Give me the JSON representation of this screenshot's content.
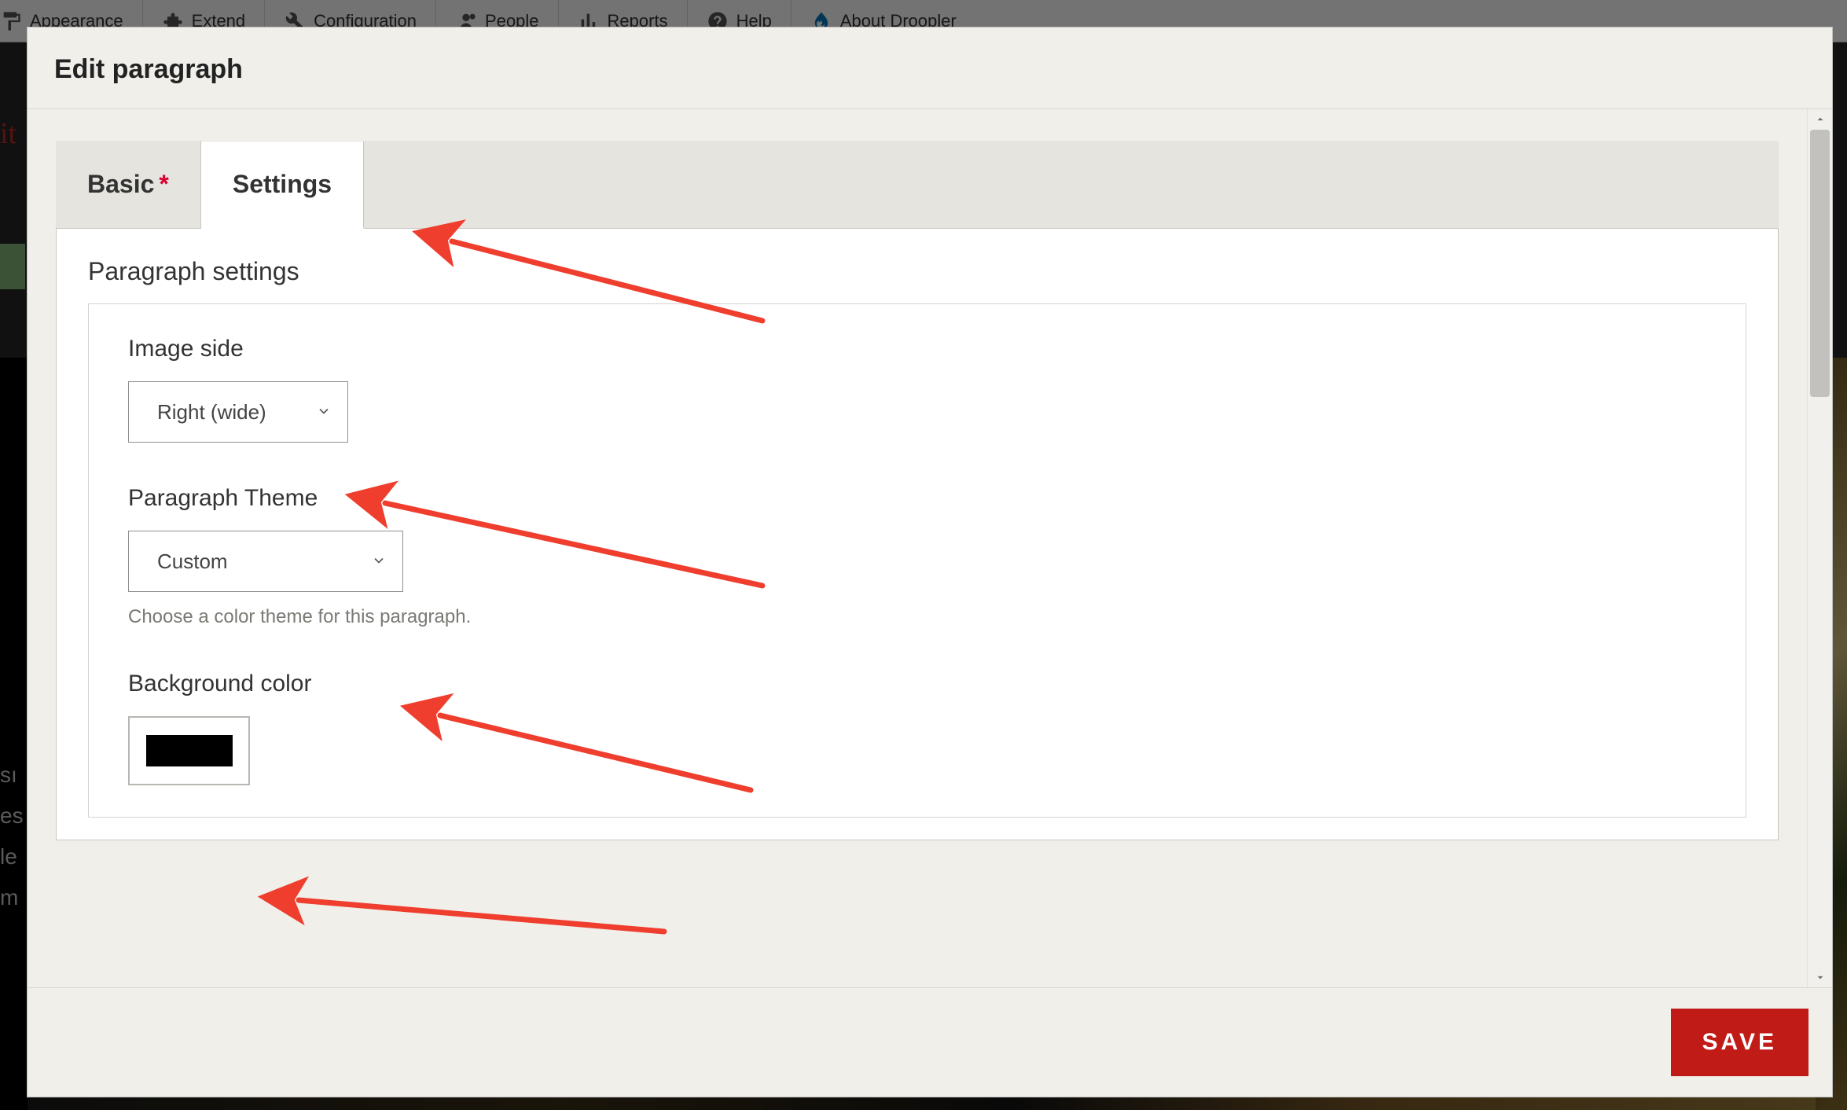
{
  "toolbar": {
    "items": [
      {
        "label": "Appearance",
        "iconName": "paint-icon"
      },
      {
        "label": "Extend",
        "iconName": "puzzle-icon"
      },
      {
        "label": "Configuration",
        "iconName": "wrench-icon"
      },
      {
        "label": "People",
        "iconName": "people-icon"
      },
      {
        "label": "Reports",
        "iconName": "reports-icon"
      },
      {
        "label": "Help",
        "iconName": "help-icon"
      },
      {
        "label": "About Droopler",
        "iconName": "drupal-icon"
      }
    ]
  },
  "bg": {
    "crumb_fragment": "it",
    "left_text_lines": [
      "sı",
      "es",
      "le",
      "m"
    ]
  },
  "modal": {
    "title": "Edit paragraph",
    "tabs": {
      "basic": {
        "label": "Basic",
        "required": true
      },
      "settings": {
        "label": "Settings"
      }
    },
    "section_title": "Paragraph settings",
    "fields": {
      "image_side": {
        "label": "Image side",
        "value": "Right (wide)"
      },
      "paragraph_theme": {
        "label": "Paragraph Theme",
        "value": "Custom",
        "help": "Choose a color theme for this paragraph."
      },
      "background_color": {
        "label": "Background color",
        "value": "#000000"
      }
    },
    "save_label": "SAVE"
  }
}
